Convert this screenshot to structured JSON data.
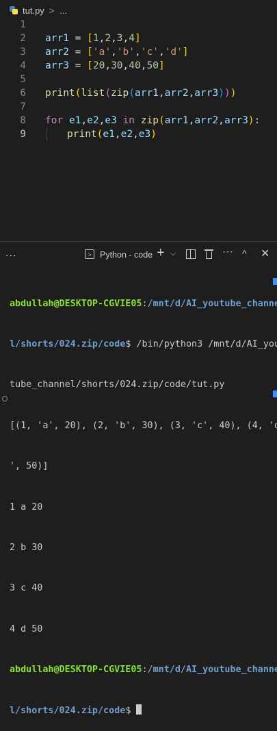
{
  "breadcrumb": {
    "file": "tut.py",
    "separator": ">",
    "more": "..."
  },
  "editor": {
    "line_numbers": [
      "1",
      "2",
      "3",
      "4",
      "5",
      "6",
      "7",
      "8",
      "9"
    ],
    "active_line": "9"
  },
  "panel": {
    "more_label": "...",
    "terminal_label": "Python - code",
    "plus": "+",
    "chevron": "⌵",
    "more": "···",
    "maximize": "^",
    "close": "✕"
  },
  "terminal": {
    "prompt1_user": "abdullah@DESKTOP-CGVIE05",
    "prompt1_sep": ":",
    "prompt1_path_a": "/mnt/d/AI_youtube_channe",
    "prompt1_path_b": "l/shorts/024.zip/code",
    "prompt1_cmd": "$ /bin/python3 /mnt/d/AI_you",
    "cmd_cont": "tube_channel/shorts/024.zip/code/tut.py",
    "out1": "[(1, 'a', 20), (2, 'b', 30), (3, 'c', 40), (4, 'd",
    "out2": "', 50)]",
    "out3": "1 a 20",
    "out4": "2 b 30",
    "out5": "3 c 40",
    "out6": "4 d 50",
    "prompt2_user": "abdullah@DESKTOP-CGVIE05",
    "prompt2_sep": ":",
    "prompt2_path_a": "/mnt/d/AI_youtube_channe",
    "prompt2_path_b": "l/shorts/024.zip/code",
    "prompt2_dollar": "$ "
  },
  "colors": {
    "background": "#1e1e1e",
    "keyword": "#c586c0",
    "variable": "#9cdcfe",
    "function": "#dcdcaa",
    "number": "#b5cea8",
    "string": "#ce9178",
    "prompt_user": "#8ae234",
    "prompt_path": "#729fcf"
  }
}
